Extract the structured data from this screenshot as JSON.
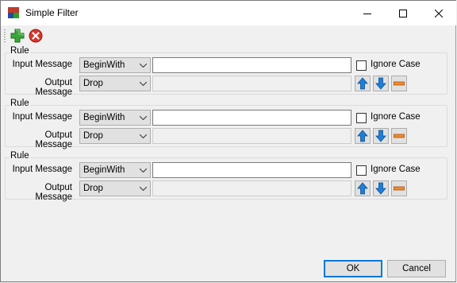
{
  "window": {
    "title": "Simple Filter"
  },
  "toolbar": {
    "add_tooltip": "",
    "remove_tooltip": ""
  },
  "rules": [
    {
      "caption": "Rule",
      "input_label": "Input Message",
      "input_mode": "BeginWith",
      "input_value": "",
      "output_label": "Output Message",
      "output_mode": "Drop",
      "ignore_case_label": "Ignore Case",
      "ignore_case_checked": false
    },
    {
      "caption": "Rule",
      "input_label": "Input Message",
      "input_mode": "BeginWith",
      "input_value": "",
      "output_label": "Output Message",
      "output_mode": "Drop",
      "ignore_case_label": "Ignore Case",
      "ignore_case_checked": false
    },
    {
      "caption": "Rule",
      "input_label": "Input Message",
      "input_mode": "BeginWith",
      "input_value": "",
      "output_label": "Output Message",
      "output_mode": "Drop",
      "ignore_case_label": "Ignore Case",
      "ignore_case_checked": false
    }
  ],
  "buttons": {
    "ok": "OK",
    "cancel": "Cancel"
  },
  "colors": {
    "accent": "#0078d7",
    "add_green": "#2e9e2e",
    "remove_red": "#d9352c",
    "arrow_blue": "#1e7fd8",
    "delete_orange": "#f08a2c"
  }
}
